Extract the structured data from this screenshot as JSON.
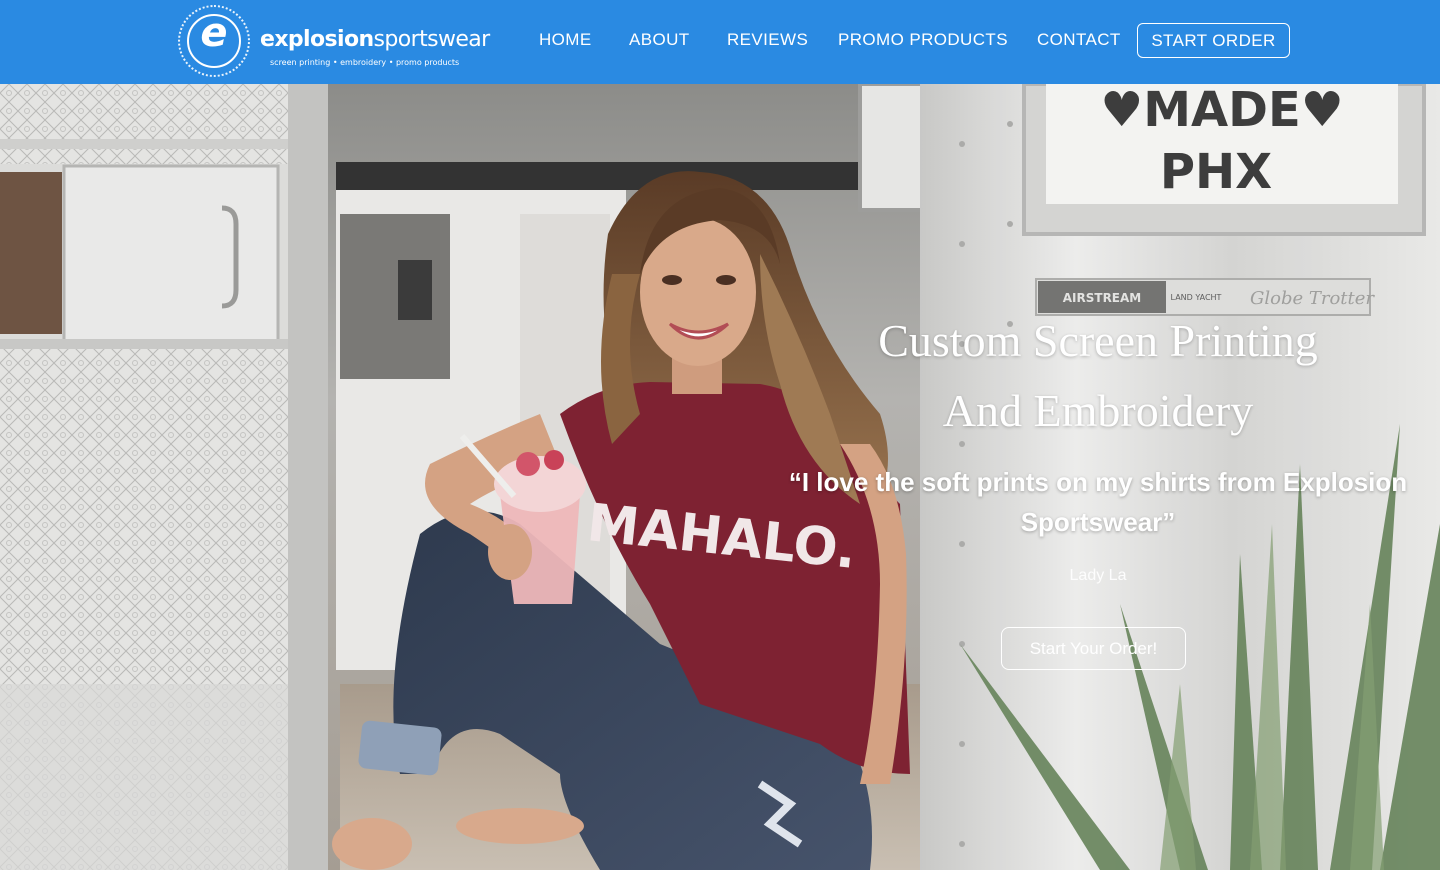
{
  "brand": {
    "name_bold": "explosion",
    "name_regular": "sportswear",
    "tagline": "screen printing • embroidery • promo products",
    "logo_letter": "e",
    "color_header": "#2a8ae2"
  },
  "nav": {
    "items": [
      "HOME",
      "ABOUT",
      "REVIEWS",
      "PROMO PRODUCTS",
      "CONTACT"
    ],
    "cta": "START ORDER"
  },
  "hero": {
    "headline_line1": "Custom Screen Printing",
    "headline_line2": "And Embroidery",
    "quote_line1": "“I love the soft prints on my shirts from Explosion",
    "quote_line2": "Sportswear”",
    "author": "Lady La",
    "button": "Start Your Order!",
    "sign_line1": "♥MADE♥",
    "sign_line2": "PHX",
    "shirt_text": "MAHALO.",
    "plate_text": "AIRSTREAM",
    "plate_text2": "LAND YACHT",
    "plate_text3": "Globe Trotter"
  }
}
